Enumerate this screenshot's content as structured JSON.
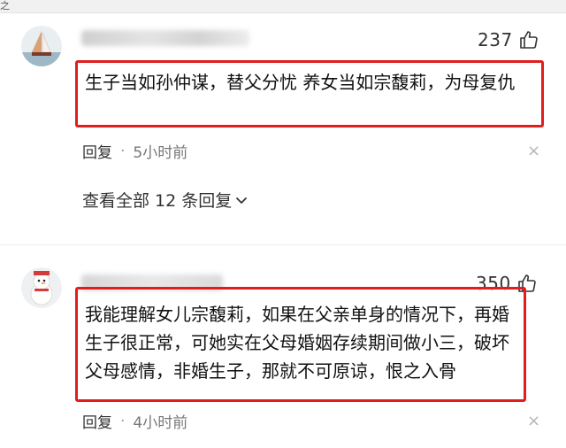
{
  "top_glyph": "之",
  "comments": [
    {
      "likes": "237",
      "text": "生子当如孙仲谋，替父分忧 养女当如宗馥莉，为母复仇",
      "reply_label": "回复",
      "separator": "·",
      "time": "5小时前",
      "close_symbol": "×",
      "view_all": "查看全部 12 条回复",
      "avatar_icon": "sailboat-avatar"
    },
    {
      "likes": "350",
      "text": "我能理解女儿宗馥莉，如果在父亲单身的情况下，再婚生子很正常，可她实在父母婚姻存续期间做小三，破坏父母感情，非婚生子，那就不可原谅，恨之入骨",
      "reply_label": "回复",
      "separator": "·",
      "time": "4小时前",
      "close_symbol": "×",
      "avatar_icon": "snowman-avatar"
    }
  ],
  "colors": {
    "highlight_border": "#e11d1d",
    "meta_text": "#777777"
  }
}
